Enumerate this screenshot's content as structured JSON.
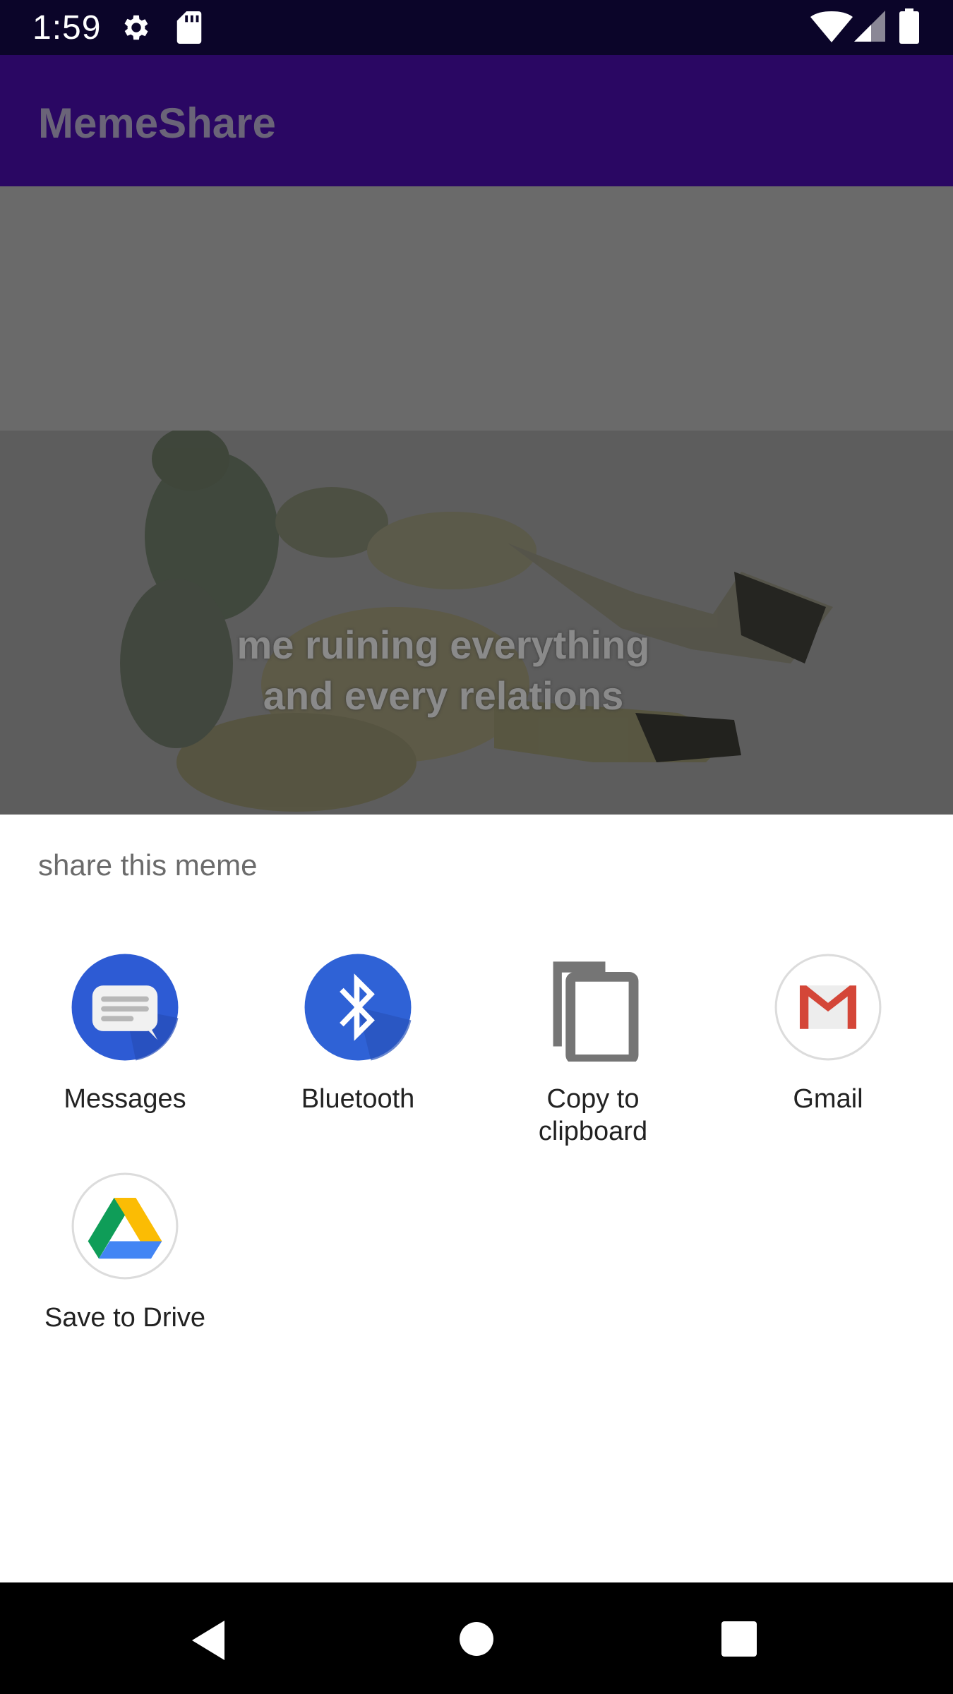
{
  "status_bar": {
    "time": "1:59",
    "icons": [
      "gear-icon",
      "sd-card-icon",
      "wifi-icon",
      "signal-icon",
      "battery-icon"
    ]
  },
  "app_bar": {
    "title": "MemeShare"
  },
  "meme": {
    "caption_line1": "me ruining everything",
    "caption_line2": "and every relations"
  },
  "share_sheet": {
    "title": "share this meme",
    "targets": [
      {
        "label": "Messages",
        "icon": "messages-icon"
      },
      {
        "label": "Bluetooth",
        "icon": "bluetooth-icon"
      },
      {
        "label_line1": "Copy to",
        "label_line2": "clipboard",
        "icon": "copy-icon"
      },
      {
        "label": "Gmail",
        "icon": "gmail-icon"
      },
      {
        "label": "Save to Drive",
        "icon": "drive-icon"
      }
    ]
  },
  "nav_bar": {
    "buttons": [
      "back-icon",
      "home-icon",
      "recents-icon"
    ]
  },
  "colors": {
    "status_bar": "#0b0529",
    "app_bar": "#2a0763",
    "sheet_bg": "#ffffff",
    "scrim": "#6b6b6b"
  }
}
